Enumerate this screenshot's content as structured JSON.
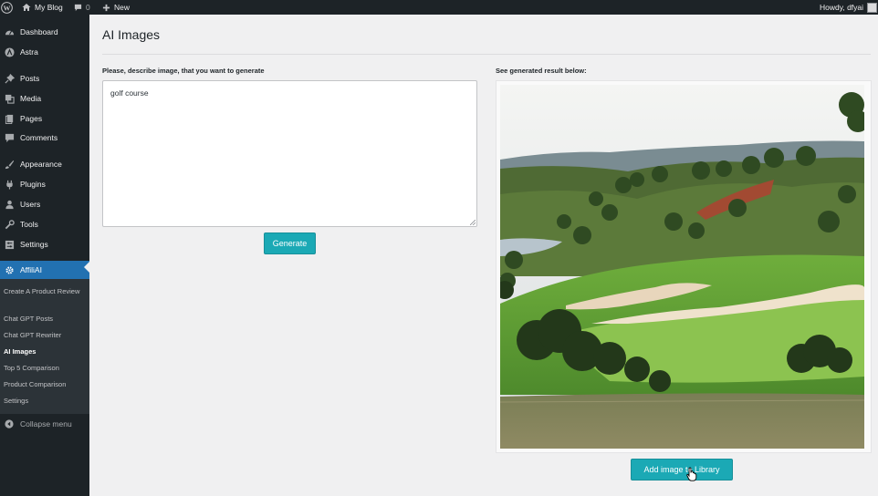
{
  "adminbar": {
    "site_name": "My Blog",
    "comments_count": "0",
    "new_label": "New",
    "howdy": "Howdy, dfyai"
  },
  "sidebar": {
    "items": [
      {
        "label": "Dashboard",
        "icon": "dashboard-icon"
      },
      {
        "label": "Astra",
        "icon": "astra-icon"
      },
      {
        "label": "Posts",
        "icon": "pin-icon"
      },
      {
        "label": "Media",
        "icon": "media-icon"
      },
      {
        "label": "Pages",
        "icon": "pages-icon"
      },
      {
        "label": "Comments",
        "icon": "comment-icon"
      },
      {
        "label": "Appearance",
        "icon": "brush-icon"
      },
      {
        "label": "Plugins",
        "icon": "plugin-icon"
      },
      {
        "label": "Users",
        "icon": "user-icon"
      },
      {
        "label": "Tools",
        "icon": "wrench-icon"
      },
      {
        "label": "Settings",
        "icon": "settings-icon"
      },
      {
        "label": "AffiliAI",
        "icon": "gear-icon"
      }
    ],
    "submenu": [
      "Create A Product Review",
      "Chat GPT Posts",
      "Chat GPT Rewriter",
      "AI Images",
      "Top 5 Comparison",
      "Product Comparison",
      "Settings"
    ],
    "collapse_label": "Collapse menu"
  },
  "page": {
    "title": "AI Images",
    "prompt_label": "Please, describe image, that you want to generate",
    "prompt_value": "golf course",
    "generate_label": "Generate",
    "result_label": "See generated result below:",
    "add_label": "Add image to Library"
  },
  "colors": {
    "accent": "#2271b1",
    "button": "#1ba9b5",
    "adminbar": "#1d2327"
  }
}
